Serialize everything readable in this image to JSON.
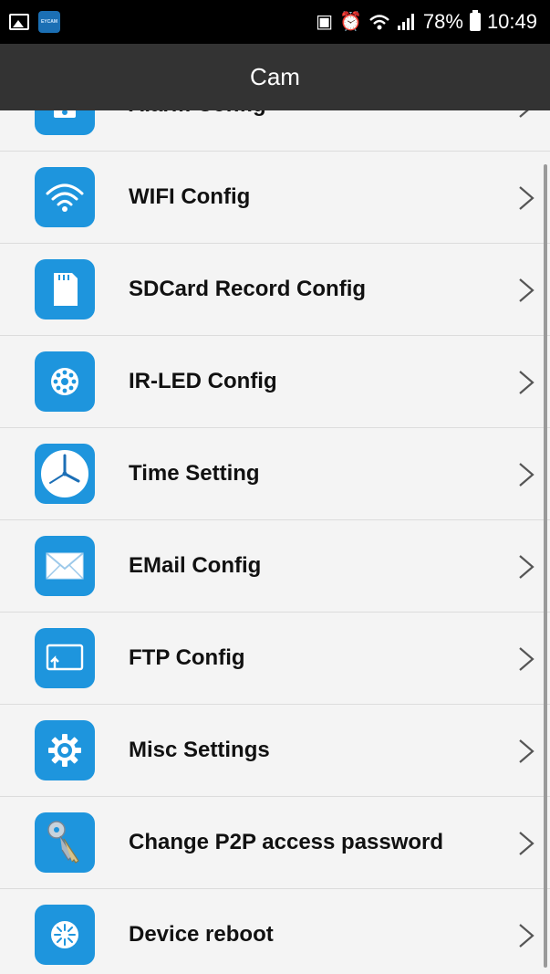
{
  "status_bar": {
    "app_badge": "EYCAM",
    "battery": "78%",
    "time": "10:49"
  },
  "header": {
    "title": "Cam"
  },
  "menu": {
    "items": [
      {
        "label": "Alarm Config",
        "icon": "alarm-icon"
      },
      {
        "label": "WIFI Config",
        "icon": "wifi-icon"
      },
      {
        "label": "SDCard Record Config",
        "icon": "sdcard-icon"
      },
      {
        "label": "IR-LED Config",
        "icon": "ir-led-icon"
      },
      {
        "label": "Time Setting",
        "icon": "clock-icon"
      },
      {
        "label": "EMail Config",
        "icon": "envelope-icon"
      },
      {
        "label": "FTP Config",
        "icon": "ftp-icon"
      },
      {
        "label": "Misc Settings",
        "icon": "gear-icon"
      },
      {
        "label": "Change P2P access password",
        "icon": "keys-icon"
      },
      {
        "label": "Device reboot",
        "icon": "reboot-icon"
      }
    ]
  },
  "colors": {
    "icon_bg": "#1e95dd",
    "title_bar": "#333333",
    "list_bg": "#f4f4f4"
  }
}
